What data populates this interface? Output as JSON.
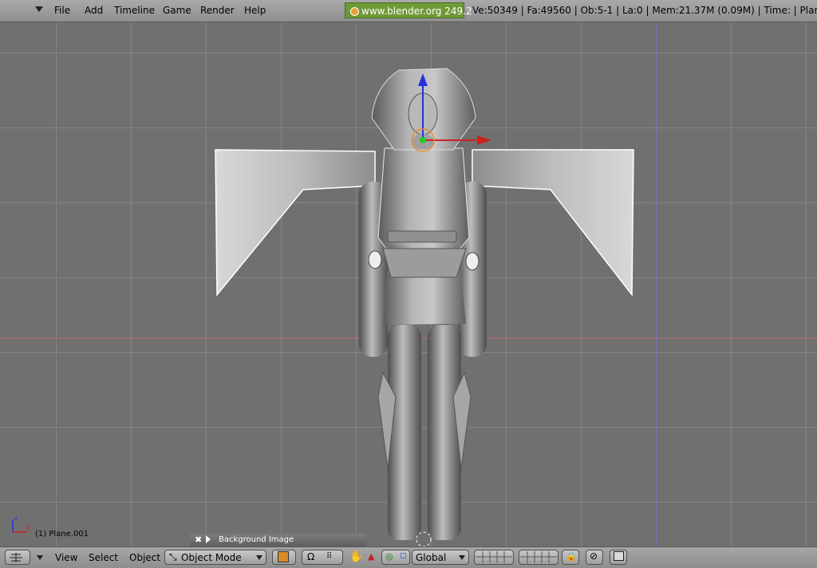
{
  "header": {
    "menu": [
      "File",
      "Add",
      "Timeline",
      "Game",
      "Render",
      "Help"
    ],
    "version_badge": "www.blender.org 249.2",
    "stats": "Ve:50349 | Fa:49560 | Ob:5-1 | La:0  | Mem:21.37M (0.09M)  | Time: | Plane"
  },
  "viewport": {
    "object_label": "(1) Plane.001",
    "axis_z": "z",
    "axis_x": "x"
  },
  "bg_panel": {
    "title": "Background Image"
  },
  "footer": {
    "menus": [
      "View",
      "Select",
      "Object"
    ],
    "mode": "Object Mode",
    "orientation": "Global"
  },
  "colors": {
    "badge": "#6f9a37",
    "x_axis": "#cc2222",
    "z_axis": "#2233dd",
    "y_axis": "#22aa22"
  }
}
